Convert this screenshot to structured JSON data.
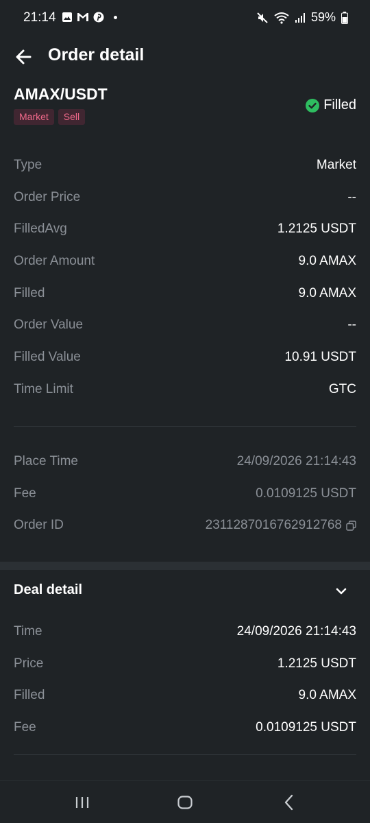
{
  "status_bar": {
    "time": "21:14",
    "battery": "59%",
    "left_icons": [
      "gallery-icon",
      "gmail-icon",
      "pinterest-icon"
    ],
    "right_icons": [
      "mute-icon",
      "wifi-icon",
      "signal-icon",
      "battery-icon"
    ]
  },
  "header": {
    "title": "Order detail"
  },
  "order": {
    "pair": "AMAX/USDT",
    "tags": [
      "Market",
      "Sell"
    ],
    "status": "Filled",
    "status_color": "#2ebd60"
  },
  "details": [
    {
      "label": "Type",
      "value": "Market"
    },
    {
      "label": "Order Price",
      "value": "--"
    },
    {
      "label": "FilledAvg",
      "value": "1.2125 USDT"
    },
    {
      "label": "Order Amount",
      "value": "9.0 AMAX"
    },
    {
      "label": "Filled",
      "value": "9.0 AMAX"
    },
    {
      "label": "Order Value",
      "value": "--"
    },
    {
      "label": "Filled Value",
      "value": "10.91 USDT"
    },
    {
      "label": "Time Limit",
      "value": "GTC"
    }
  ],
  "meta": [
    {
      "label": "Place Time",
      "value": "24/09/2026 21:14:43"
    },
    {
      "label": "Fee",
      "value": "0.0109125 USDT"
    },
    {
      "label": "Order ID",
      "value": "2311287016762912768"
    }
  ],
  "deal": {
    "title": "Deal detail",
    "rows": [
      {
        "label": "Time",
        "value": "24/09/2026 21:14:43"
      },
      {
        "label": "Price",
        "value": "1.2125 USDT"
      },
      {
        "label": "Filled",
        "value": "9.0 AMAX"
      },
      {
        "label": "Fee",
        "value": "0.0109125 USDT"
      }
    ]
  },
  "nav": [
    "recent-apps-icon",
    "home-icon",
    "back-icon"
  ],
  "colors": {
    "background": "#1f2326",
    "muted_text": "#8b9097",
    "tag_bg": "#402631",
    "tag_text": "#f0698a"
  }
}
